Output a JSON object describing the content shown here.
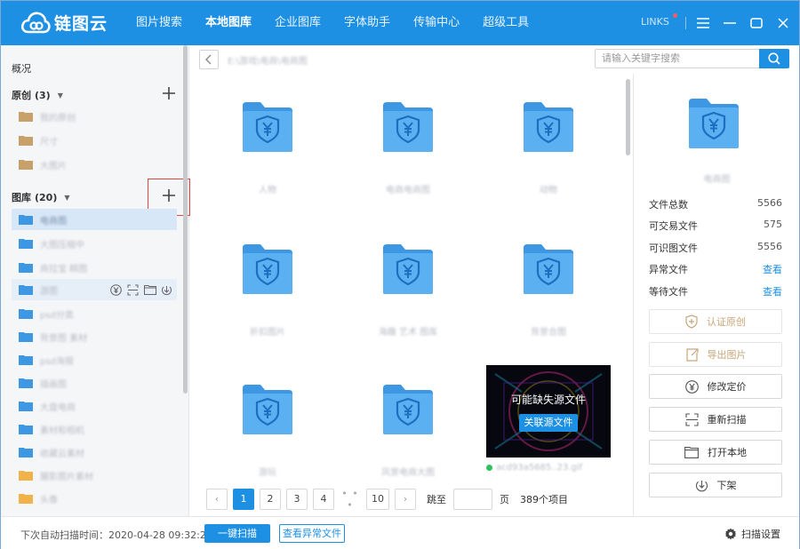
{
  "app": {
    "name": "链图云",
    "user": "LINKS"
  },
  "nav": [
    "图片搜索",
    "本地图库",
    "企业图库",
    "字体助手",
    "传输中心",
    "超级工具"
  ],
  "sidebar": {
    "overview": "概况",
    "original": {
      "title": "原创",
      "count": "(3)",
      "items": [
        "我的原创",
        "尺寸",
        "大图片"
      ]
    },
    "library": {
      "title": "图库",
      "count": "(20)",
      "items": [
        "电商图",
        "大图压缩中",
        "商拉宝 精图",
        "游图",
        "psd分类",
        "背景图 素材",
        "psd海报",
        "插画图",
        "大盘电商",
        "素材和相机",
        "收藏云素材",
        "摄影图片素材",
        "头像"
      ]
    }
  },
  "path": "E:\\游戏\\电商\\电商图",
  "search": {
    "placeholder": "请输入关键字搜索"
  },
  "grid": {
    "folders": [
      "人物",
      "电商电商图",
      "动物",
      "折扣图片",
      "海趣 艺术 图库",
      "背景合图",
      "游玩",
      "风景电商大图"
    ],
    "thumb": {
      "overlay_text": "可能缺失源文件",
      "button": "关联源文件",
      "filename": "acd93a5685..23.gif"
    }
  },
  "pager": {
    "pages": [
      "1",
      "2",
      "3",
      "4",
      "10"
    ],
    "dots": "• • •",
    "jump_label": "跳至",
    "page_unit": "页",
    "total": "389个项目"
  },
  "right": {
    "folder_name": "电商图",
    "stats": [
      {
        "label": "文件总数",
        "value": "5566"
      },
      {
        "label": "可交易文件",
        "value": "575"
      },
      {
        "label": "可识图文件",
        "value": "5556"
      },
      {
        "label": "异常文件",
        "value": "查看"
      },
      {
        "label": "等待文件",
        "value": "查看"
      }
    ],
    "actions": [
      "认证原创",
      "导出图片",
      "修改定价",
      "重新扫描",
      "打开本地",
      "下架"
    ]
  },
  "bottom": {
    "scan_time": "下次自动扫描时间：2020-04-28 09:32:28",
    "scan_btn": "一键扫描",
    "abnormal_btn": "查看异常文件",
    "settings": "扫描设置"
  },
  "colors": {
    "primary": "#1e90e4",
    "folder": "#5bb0f2",
    "folder_tab": "#3d97e3",
    "original_folder": "#c8a06a",
    "highlight_border": "#e2473e"
  }
}
